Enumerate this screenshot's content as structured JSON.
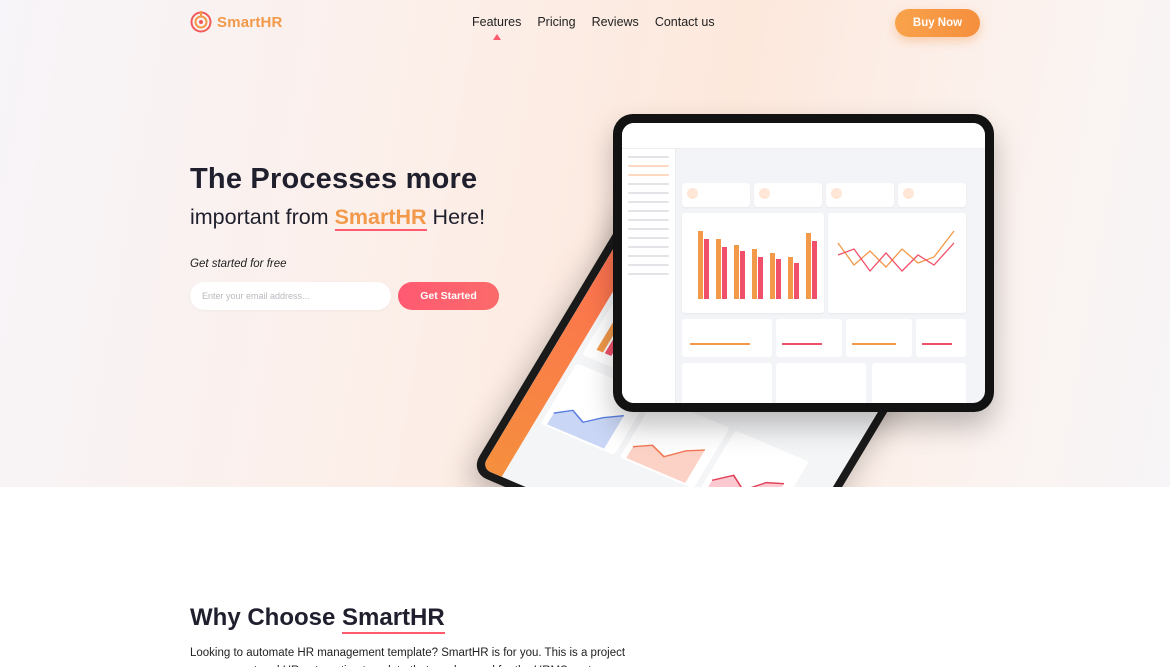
{
  "nav": {
    "logo_text": "SmartHR",
    "links": [
      "Features",
      "Pricing",
      "Reviews",
      "Contact us"
    ],
    "buy_label": "Buy Now"
  },
  "hero": {
    "title": "The Processes more",
    "subtitle_before": "important from ",
    "subtitle_brand": "SmartHR",
    "subtitle_after": " Here!",
    "tagline": "Get started for free",
    "email_placeholder": "Enter your email address...",
    "cta_label": "Get Started"
  },
  "why": {
    "title_before": "Why Choose ",
    "title_brand": "SmartHR",
    "text": "Looking to automate HR management template? SmartHR is for you. This is a project management and HR automation template that can be used for the HRMS system."
  },
  "colors": {
    "accent_orange": "#f2994a",
    "accent_red": "#ff5a6e"
  }
}
